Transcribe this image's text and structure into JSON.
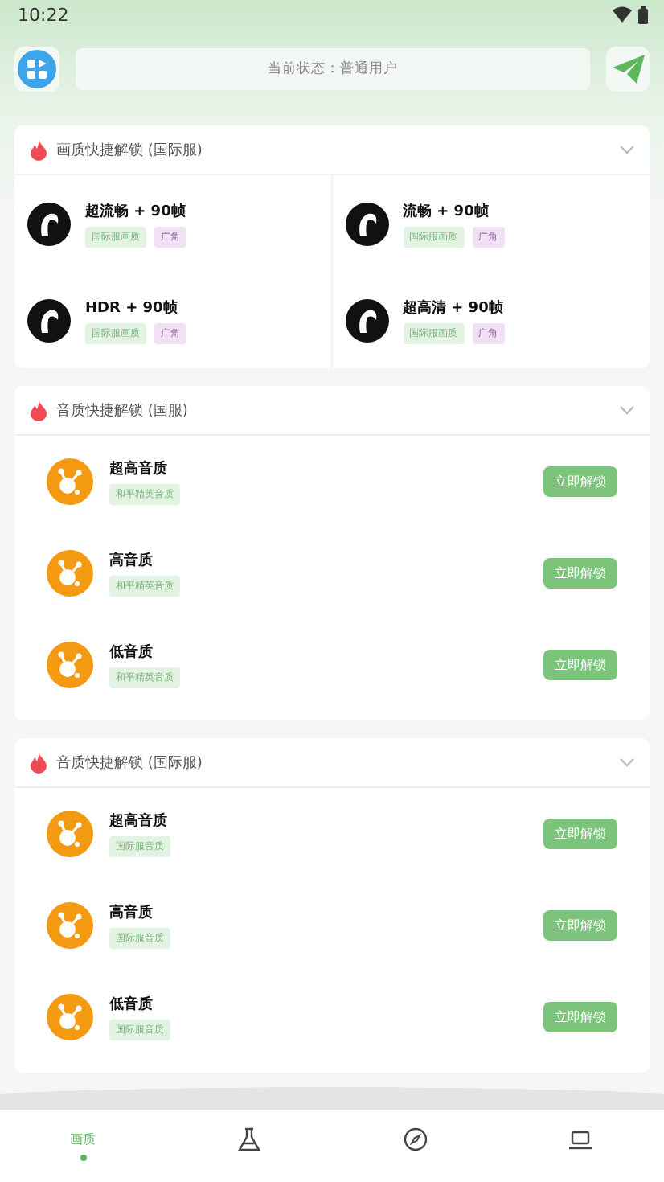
{
  "status_bar": {
    "time": "10:22"
  },
  "header": {
    "status_text": "当前状态：普通用户"
  },
  "sections": [
    {
      "kind": "grid",
      "title": "画质快捷解锁 (国际服)",
      "items": [
        {
          "name": "超流畅 + 90帧",
          "tags": [
            {
              "text": "国际服画质",
              "color": "#e3f3e3"
            },
            {
              "text": "广角",
              "color": "#f1e1f5"
            }
          ]
        },
        {
          "name": "流畅 + 90帧",
          "tags": [
            {
              "text": "国际服画质",
              "color": "#e3f3e3"
            },
            {
              "text": "广角",
              "color": "#f1e1f5"
            }
          ]
        },
        {
          "name": "HDR + 90帧",
          "tags": [
            {
              "text": "国际服画质",
              "color": "#e3f3e3"
            },
            {
              "text": "广角",
              "color": "#f1e1f5"
            }
          ]
        },
        {
          "name": "超高清 + 90帧",
          "tags": [
            {
              "text": "国际服画质",
              "color": "#e3f3e3"
            },
            {
              "text": "广角",
              "color": "#f1e1f5"
            }
          ]
        }
      ]
    },
    {
      "kind": "list",
      "title": "音质快捷解锁 (国服)",
      "items": [
        {
          "name": "超高音质",
          "tags": [
            {
              "text": "和平精英音质",
              "color": "#e3f3e3"
            }
          ],
          "button": "立即解锁"
        },
        {
          "name": "高音质",
          "tags": [
            {
              "text": "和平精英音质",
              "color": "#e3f3e3"
            }
          ],
          "button": "立即解锁"
        },
        {
          "name": "低音质",
          "tags": [
            {
              "text": "和平精英音质",
              "color": "#e3f3e3"
            }
          ],
          "button": "立即解锁"
        }
      ]
    },
    {
      "kind": "list",
      "title": "音质快捷解锁 (国际服)",
      "items": [
        {
          "name": "超高音质",
          "tags": [
            {
              "text": "国际服音质",
              "color": "#e3f3e3"
            }
          ],
          "button": "立即解锁"
        },
        {
          "name": "高音质",
          "tags": [
            {
              "text": "国际服音质",
              "color": "#e3f3e3"
            }
          ],
          "button": "立即解锁"
        },
        {
          "name": "低音质",
          "tags": [
            {
              "text": "国际服音质",
              "color": "#e3f3e3"
            }
          ],
          "button": "立即解锁"
        }
      ]
    }
  ],
  "nav": [
    {
      "kind": "text",
      "label": "画质",
      "selected": true
    },
    {
      "kind": "flask",
      "selected": false
    },
    {
      "kind": "compass",
      "selected": false
    },
    {
      "kind": "device",
      "selected": false
    }
  ]
}
